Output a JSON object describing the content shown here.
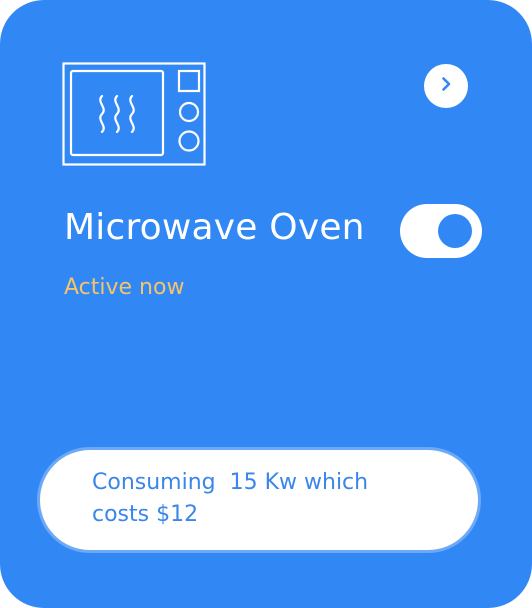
{
  "device": {
    "name": "Microwave Oven",
    "status": "Active now",
    "toggle_on": true
  },
  "usage": {
    "text": "Consuming  15 Kw which costs $12"
  },
  "icons": {
    "device_icon": "microwave-icon",
    "nav_icon": "chevron-right-icon"
  },
  "colors": {
    "card_background": "#3188f5",
    "status_accent": "#f5c46a",
    "usage_text": "#3a86ea"
  }
}
